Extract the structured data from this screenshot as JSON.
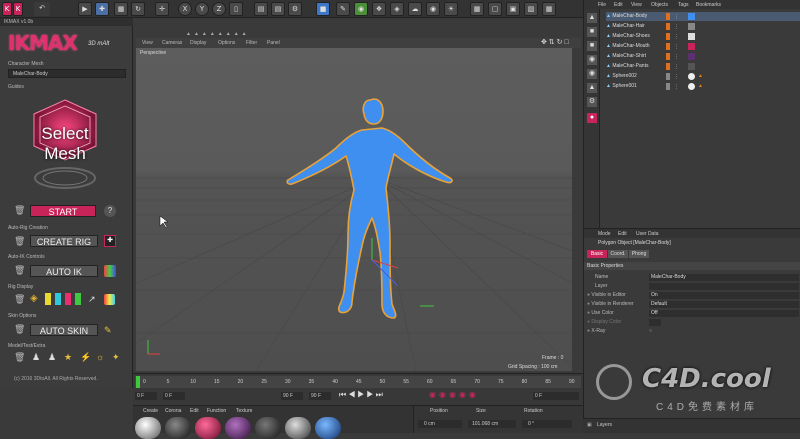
{
  "plugin": {
    "window_title": "IKMAX v1.0b",
    "logo_text": "IKMAX",
    "logo_sub": "3D mAlt",
    "char_mesh_label": "Character Mesh",
    "char_mesh_value": "MaleChar-Body",
    "guides_label": "Guides",
    "select_mesh_line1": "Select",
    "select_mesh_line2": "Mesh",
    "start_label": "START",
    "help_label": "?",
    "autorig_label": "Auto-Rig Creation",
    "create_rig_label": "CREATE RIG",
    "autoik_section": "Auto-IK Controls",
    "auto_ik_label": "AUTO IK",
    "rig_display_label": "Rig Display",
    "skin_options_label": "Skin Options",
    "auto_skin_label": "AUTO SKIN",
    "model_section": "Model/Test/Extra",
    "copyright": "(c) 2016 3DtoAll. All Rights Reserved."
  },
  "topbar": {
    "axis_x": "X",
    "axis_y": "Y",
    "axis_z": "Z"
  },
  "viewport": {
    "menu": [
      "View",
      "Cameras",
      "Display",
      "Options",
      "Filter",
      "Panel"
    ],
    "label": "Perspective",
    "frame": "Frame : 0",
    "grid": "Grid Spacing : 100 cm"
  },
  "object_manager": {
    "menu": [
      "File",
      "Edit",
      "View",
      "Objects",
      "Tags",
      "Bookmarks"
    ],
    "objects": [
      "MaleChar-Body",
      "MaleChar-Hair",
      "MaleChar-Shoes",
      "MaleChar-Mouth",
      "MaleChar-Shirt",
      "MaleChar-Pants",
      "Sphere002",
      "Sphere001"
    ]
  },
  "attributes": {
    "menu": [
      "Mode",
      "Edit",
      "User Data"
    ],
    "object_title": "Polygon Object [MaleChar-Body]",
    "tabs": [
      "Basic",
      "Coord.",
      "Phong"
    ],
    "section": "Basic Properties",
    "rows": [
      {
        "label": "Name",
        "value": "MaleChar-Body"
      },
      {
        "label": "Layer",
        "value": ""
      },
      {
        "label": "Visible in Editor",
        "value": "On"
      },
      {
        "label": "Visible in Renderer",
        "value": "Default"
      },
      {
        "label": "Use Color",
        "value": "Off"
      },
      {
        "label": "Display Color",
        "value": ""
      },
      {
        "label": "X-Ray",
        "value": ""
      }
    ]
  },
  "timeline": {
    "ticks": [
      "0",
      "5",
      "10",
      "15",
      "20",
      "25",
      "30",
      "35",
      "40",
      "45",
      "50",
      "55",
      "60",
      "65",
      "70",
      "75",
      "80",
      "85",
      "90"
    ],
    "start_field": "0 F",
    "start_field2": "0 F",
    "end_field": "90 F",
    "end_field2": "90 F",
    "current_frame": "0 F"
  },
  "materials": {
    "menu": [
      "Create",
      "Corona",
      "Edit",
      "Function",
      "Texture"
    ]
  },
  "coords": {
    "headers": [
      "Position",
      "Size",
      "Rotation"
    ],
    "x_pos": "0 cm",
    "x_size": "101.068 cm",
    "h_rot": "0 °"
  },
  "layers": {
    "label": "Layers"
  },
  "watermark": {
    "text": "C4D.cool",
    "sub": "C4D免费素材库"
  },
  "colors": {
    "accent_pink": "#c8245a",
    "mesh_blue": "#3f8ff0",
    "mesh_outline": "#e8a23a",
    "ui_dark": "#3a3a3a"
  }
}
